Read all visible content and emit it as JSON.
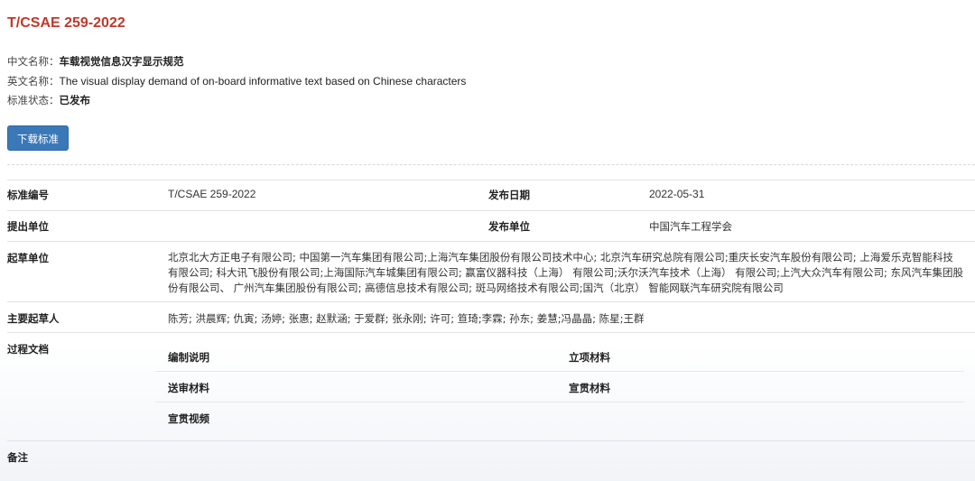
{
  "title": "T/CSAE 259-2022",
  "info": {
    "cn_name_label": "中文名称：",
    "cn_name": "车载视觉信息汉字显示规范",
    "en_name_label": "英文名称：",
    "en_name": "The visual display demand of on-board informative text based on Chinese characters",
    "status_label": "标准状态：",
    "status": "已发布"
  },
  "download_button": "下载标准",
  "table": {
    "std_no_label": "标准编号",
    "std_no": "T/CSAE 259-2022",
    "pub_date_label": "发布日期",
    "pub_date": "2022-05-31",
    "proposer_label": "提出单位",
    "proposer": "",
    "publisher_label": "发布单位",
    "publisher": "中国汽车工程学会",
    "drafters_label": "起草单位",
    "drafters_lines": [
      "北京北大方正电子有限公司; 中国第一汽车集团有限公司;上海汽车集团股份有限公司技术中心; 北京汽车研究总院有限公司;重庆长安汽车股份有限公司; 上海爱乐克智能科技",
      "有限公司; 科大讯飞股份有限公司;上海国际汽车城集团有限公司; 赢富仪器科技（上海） 有限公司;沃尔沃汽车技术（上海） 有限公司;上汽大众汽车有限公司; 东风汽车集团股",
      "份有限公司、 广州汽车集团股份有限公司; 高德信息技术有限公司; 斑马网络技术有限公司;国汽（北京） 智能网联汽车研究院有限公司"
    ],
    "main_drafters_label": "主要起草人",
    "main_drafters": "陈芳; 洪晨辉; 仇寅; 汤婷; 张惠; 赵默涵; 于爱群; 张永刚; 许可; 笪琦;李霖; 孙东; 姜慧;冯晶晶; 陈星;王群",
    "process_docs_label": "过程文档",
    "process_docs": {
      "doc1": "编制说明",
      "doc2": "立项材料",
      "doc3": "送审材料",
      "doc4": "宣贯材料",
      "doc5": "宣贯视频"
    },
    "remarks_label": "备注"
  }
}
